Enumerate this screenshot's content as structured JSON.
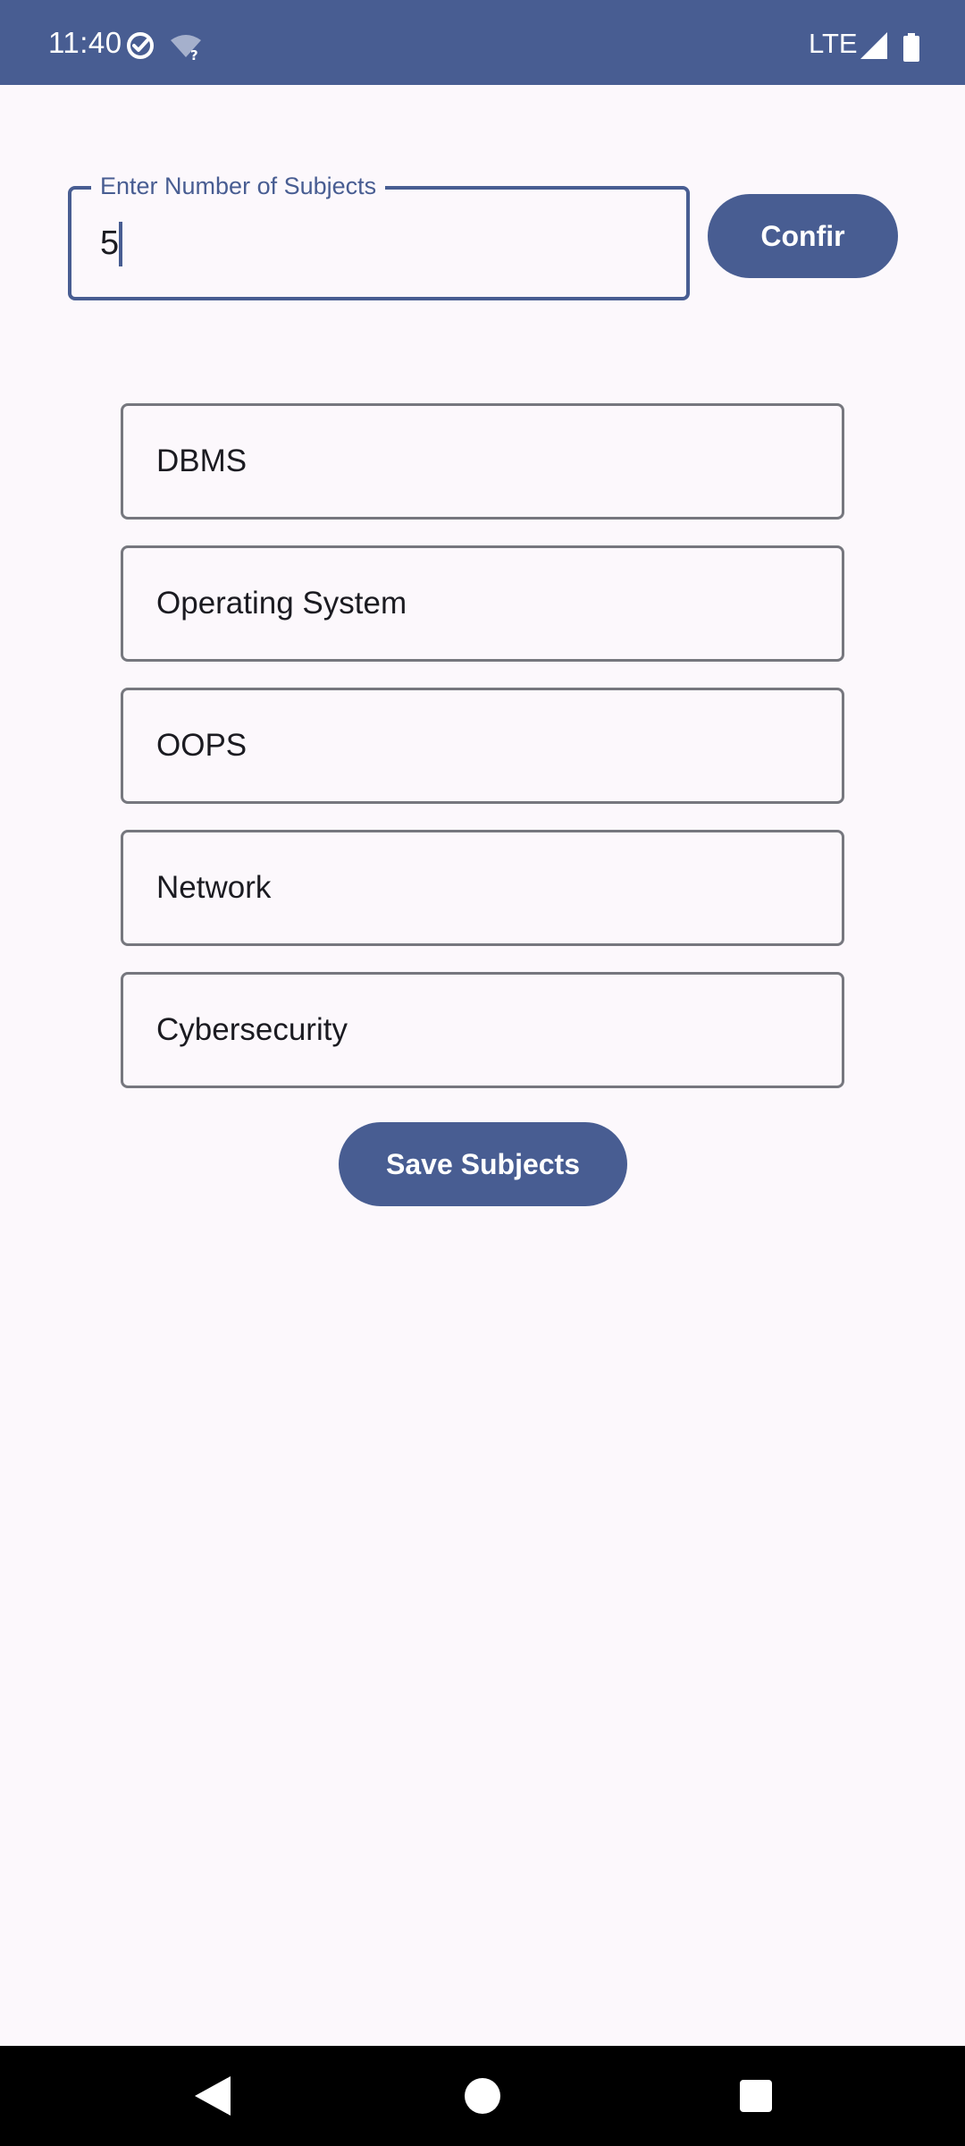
{
  "status_bar": {
    "time": "11:40",
    "network": "LTE",
    "icons": [
      "check-circle-icon",
      "wifi-unknown-icon",
      "signal-icon",
      "battery-icon"
    ]
  },
  "count_field": {
    "label": "Enter Number of Subjects",
    "value": "5"
  },
  "confirm_button": {
    "label": "Confir"
  },
  "subjects": [
    {
      "value": "DBMS"
    },
    {
      "value": "Operating System"
    },
    {
      "value": "OOPS"
    },
    {
      "value": "Network"
    },
    {
      "value": "Cybersecurity"
    }
  ],
  "save_button": {
    "label": "Save Subjects"
  },
  "nav_bar": {
    "icons": [
      "back-icon",
      "home-icon",
      "recents-icon"
    ]
  },
  "colors": {
    "primary": "#485D92",
    "background": "#FCF8FC",
    "outline": "#76777E",
    "text": "#1B1B21"
  }
}
